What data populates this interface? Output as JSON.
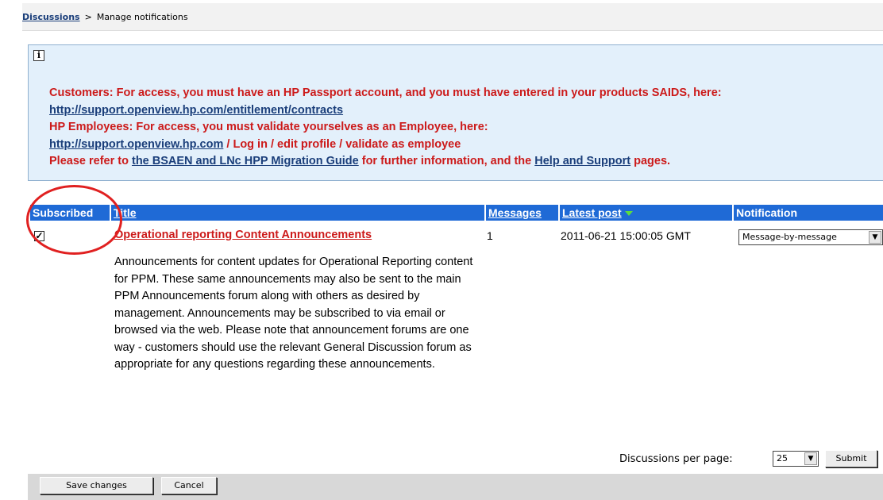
{
  "breadcrumb": {
    "link": "Discussions",
    "separator": ">",
    "current": "Manage notifications"
  },
  "info": {
    "icon": "info-icon",
    "line1": "Customers: For access, you must have an HP Passport account, and you must have entered in your products SAIDS, here:",
    "link1": "http://support.openview.hp.com/entitlement/contracts",
    "line3": "HP Employees: For access, you must validate yourselves as an Employee, here:",
    "link2": "http://support.openview.hp.com",
    "line4_suffix": " / Log in / edit profile / validate as employee",
    "line5_prefix": "Please refer to ",
    "guide_link": "the BSAEN and LNc HPP Migration Guide",
    "line5_middle": " for further information, and the ",
    "help_link": "Help and Support",
    "line5_suffix": " pages."
  },
  "table": {
    "headers": {
      "subscribed": "Subscribed",
      "title": "Title",
      "messages": "Messages",
      "latest_post": "Latest post",
      "notification": "Notification"
    },
    "rows": [
      {
        "subscribed": true,
        "title": "Operational reporting Content Announcements",
        "messages": "1",
        "latest_post": "2011-06-21 15:00:05 GMT",
        "notification": "Message-by-message",
        "description": "Announcements for content updates for Operational Reporting content for PPM. These same announcements may also be sent to the main PPM Announcements forum along with others as desired by management. Announcements may be subscribed to via email or browsed via the web. Please note that announcement forums are one way - customers should use the relevant General Discussion forum as appropriate for any questions regarding these announcements."
      }
    ]
  },
  "pagination": {
    "label": "Discussions per page:",
    "value": "25",
    "submit": "Submit"
  },
  "actions": {
    "save": "Save changes",
    "cancel": "Cancel"
  },
  "colors": {
    "header_bg": "#1f6ad6",
    "alert_text": "#cc1a1a",
    "link": "#1a3e7a",
    "info_bg": "#e3f0fb",
    "annotation": "#e02020"
  }
}
